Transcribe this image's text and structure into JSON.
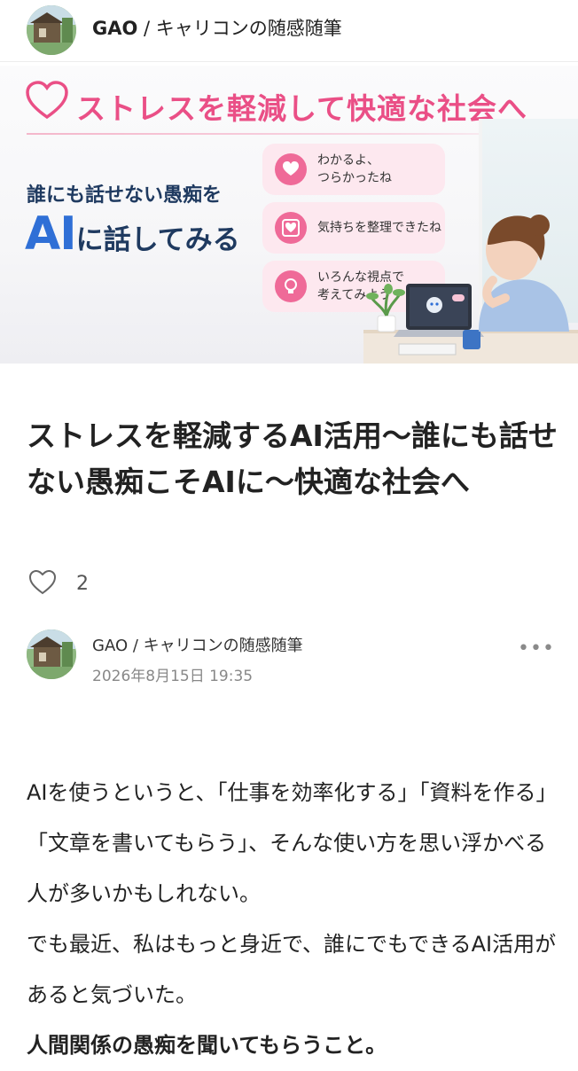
{
  "header": {
    "author": "GAO",
    "separator": " / ",
    "magazine": "キャリコンの随感随筆"
  },
  "banner": {
    "title": "ストレスを軽減して快適な社会へ",
    "lead": "誰にも話せない愚痴を",
    "ai_big": "AI",
    "ai_rest": "に話してみる",
    "bubbles": [
      {
        "icon": "heart-icon",
        "text": "わかるよ、\nつらかったね"
      },
      {
        "icon": "heart-frame-icon",
        "text": "気持ちを整理できたね"
      },
      {
        "icon": "lightbulb-icon",
        "text": "いろんな視点で\n考えてみよう"
      }
    ],
    "colors": {
      "pink": "#ea4f86",
      "navy": "#1f3a60",
      "blue": "#2f6fd6"
    }
  },
  "article": {
    "title": "ストレスを軽減するAI活用〜誰にも話せない愚痴こそAIに〜快適な社会へ",
    "like_count": "2",
    "author_line": "GAO / キャリコンの随感随筆",
    "date": "2026年8月15日 19:35",
    "more_label": "•••",
    "paragraph1": "AIを使うというと、「仕事を効率化する」「資料を作る」「文章を書いてもらう」、そんな使い方を思い浮かべる人が多いかもしれない。",
    "paragraph2": "でも最近、私はもっと身近で、誰にでもできるAI活用があると気づいた。",
    "paragraph3": "人間関係の愚痴を聞いてもらうこと。"
  }
}
